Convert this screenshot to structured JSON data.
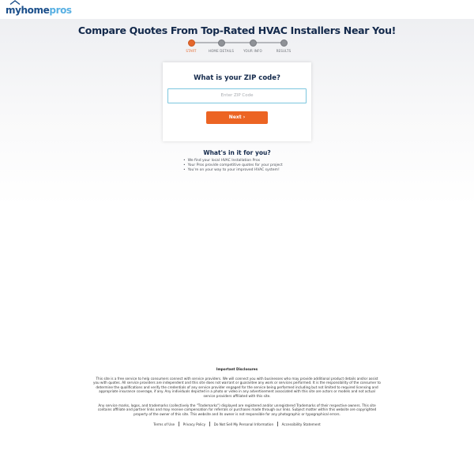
{
  "brand": {
    "logo_my": "my",
    "logo_home": "home",
    "logo_pros": "pros"
  },
  "headline": "Compare Quotes From Top-Rated HVAC Installers Near You!",
  "progress": {
    "steps": [
      "START",
      "HOME DETAILS",
      "YOUR INFO",
      "RESULTS"
    ],
    "active_index": 0
  },
  "form": {
    "question": "What is your ZIP code?",
    "zip_placeholder": "Enter ZIP Code",
    "zip_value": "",
    "next_label": "Next ›"
  },
  "benefits": {
    "title": "What's in it for you?",
    "items": [
      "We find your local HVAC Installation Pros",
      "Your Pros provide competitive quotes for your project",
      "You're on your way to your improved HVAC system!"
    ]
  },
  "disclosures": {
    "title": "Important Disclosures",
    "para1": "This site is a free service to help consumers connect with service providers. We will connect you with businesses who may provide additional product details and/or assist you with quotes. All service providers are independent and this site does not warrant or guarantee any work or services performed. It is the responsibility of the consumer to determine the qualifications and verify the credentials of any service provider engaged for the service being performed including but not limited to required licensing and appropriate insurance coverage, if any. Any individuals depicted in a photo or video in any advertisement associated with this site are actors or models and not actual service providers affiliated with this site.",
    "para2": "Any service marks, logos, and trademarks (collectively the \"Trademarks\") displayed are registered and/or unregistered Trademarks of their respective owners. This site contains affiliate and partner links and may receive compensation for referrals or purchases made through our links. Subject matter within this website are copyrighted property of the owner of this site. This website and its owner is not responsible for any photographic or typographical errors."
  },
  "footer": {
    "links": [
      "Terms of Use",
      "Privacy Policy",
      "Do Not Sell My Personal Information",
      "Accessibility Statement"
    ]
  },
  "colors": {
    "accent": "#ec6423",
    "navy": "#13294b",
    "input_border": "#7cc6de",
    "logo_light": "#58b0e3"
  }
}
